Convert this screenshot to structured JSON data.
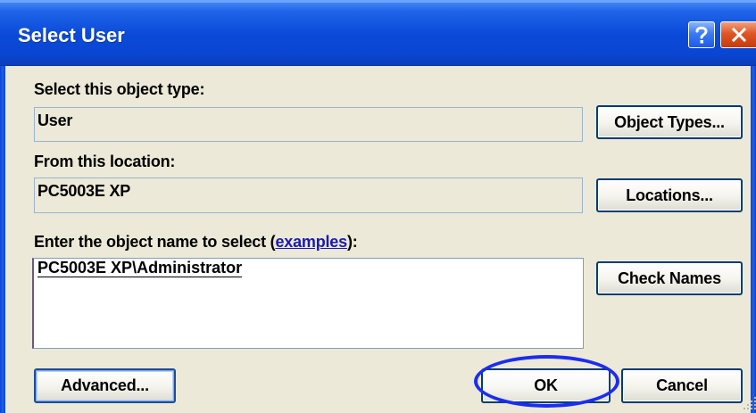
{
  "window": {
    "title": "Select User"
  },
  "titlebar_buttons": {
    "help_icon": "help-icon",
    "close_icon": "close-icon"
  },
  "object_type": {
    "label": "Select this object type:",
    "value": "User",
    "button_label": "Object Types..."
  },
  "location": {
    "label": "From this location:",
    "value": "PC5003E XP",
    "button_label": "Locations..."
  },
  "object_name": {
    "label_prefix": "Enter the object name to select (",
    "label_link": "examples",
    "label_suffix": "):",
    "value": "PC5003E XP\\Administrator",
    "check_button_label": "Check Names"
  },
  "footer": {
    "advanced_label": "Advanced...",
    "ok_label": "OK",
    "cancel_label": "Cancel"
  },
  "colors": {
    "titlebar": "#0a49d8",
    "window": "#ece9d8",
    "annotation": "#1b2df0"
  }
}
